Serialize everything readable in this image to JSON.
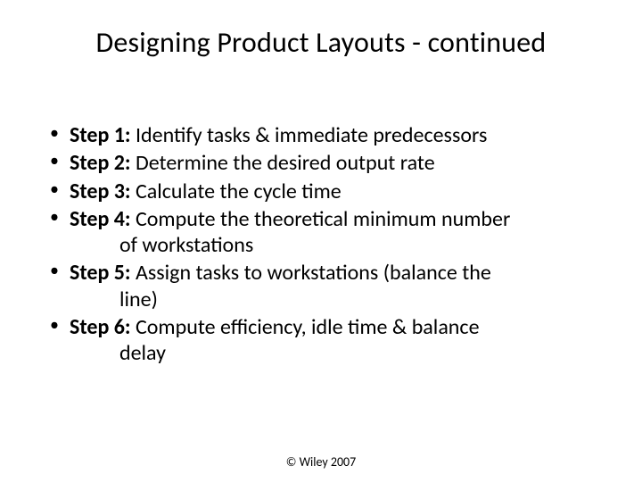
{
  "title": "Designing Product Layouts - continued",
  "steps": [
    {
      "label": "Step 1:",
      "text": " Identify tasks & immediate predecessors",
      "cont": ""
    },
    {
      "label": "Step 2:",
      "text": " Determine the desired output rate",
      "cont": ""
    },
    {
      "label": "Step 3:",
      "text": " Calculate the cycle time",
      "cont": ""
    },
    {
      "label": "Step 4:",
      "text": " Compute the theoretical minimum number",
      "cont": "of workstations"
    },
    {
      "label": "Step 5:",
      "text": " Assign tasks to workstations (balance the",
      "cont": "line)"
    },
    {
      "label": "Step 6:",
      "text": " Compute efficiency, idle time & balance",
      "cont": "delay"
    }
  ],
  "footer": "© Wiley 2007"
}
